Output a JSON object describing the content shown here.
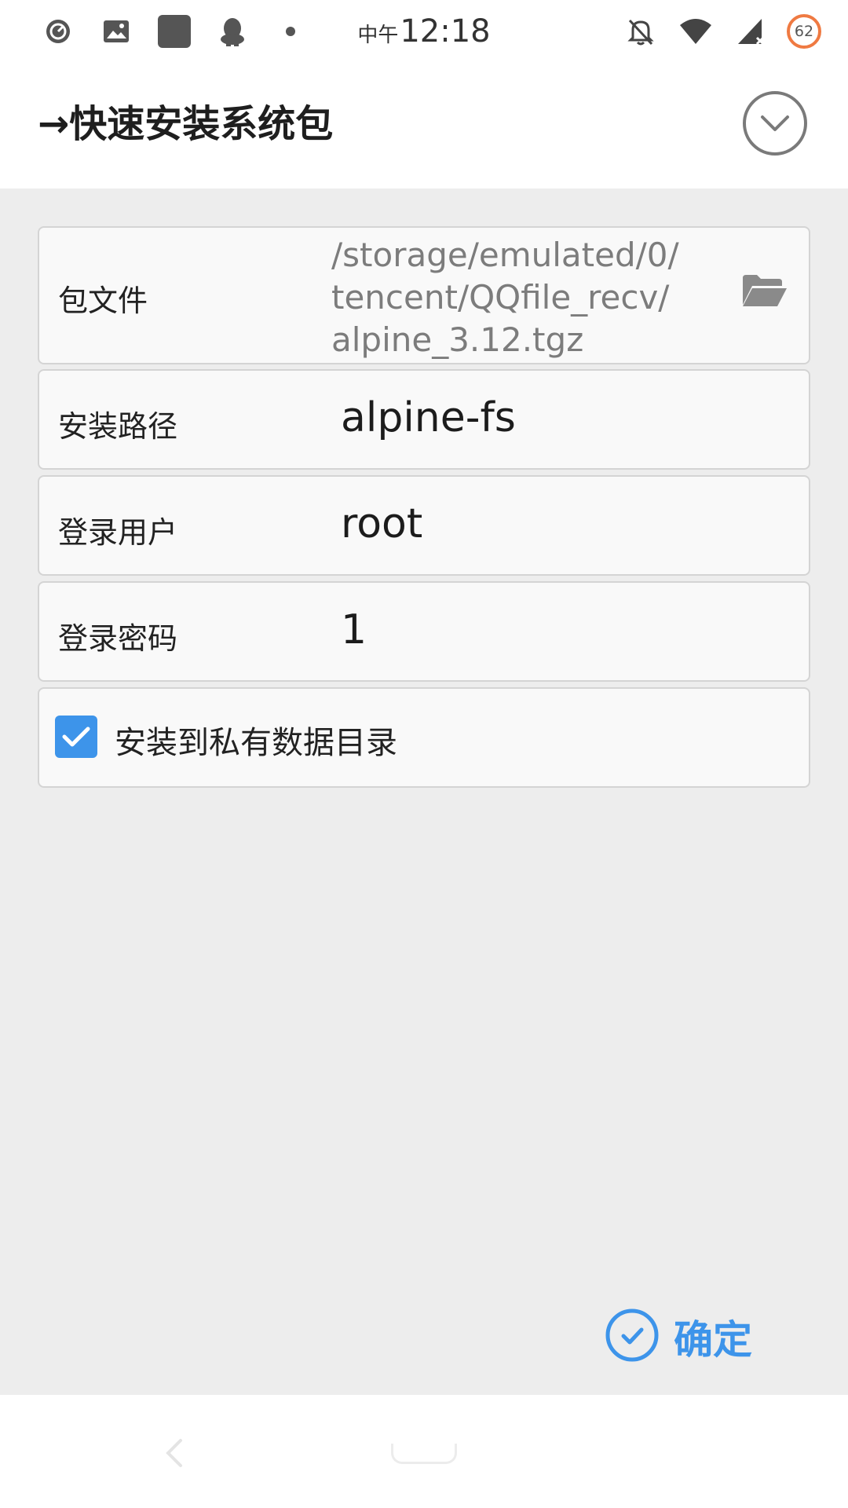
{
  "status_bar": {
    "ampm": "中午",
    "time": "12:18",
    "battery": "62",
    "left_icons": [
      "speed-icon",
      "gallery-icon",
      "app-icon",
      "qq-icon",
      "dot-icon"
    ],
    "right_icons": [
      "bell-off-icon",
      "wifi-icon",
      "signal-icon",
      "battery-icon"
    ]
  },
  "header": {
    "title": "→快速安装系统包",
    "collapse_icon": "chevron-down-circle-icon"
  },
  "form": {
    "package_file": {
      "label": "包文件",
      "value": "/storage/emulated/0/\ntencent/QQfile_recv/\nalpine_3.12.tgz",
      "icon": "folder-open-icon"
    },
    "install_path": {
      "label": "安装路径",
      "value": "alpine-fs"
    },
    "login_user": {
      "label": "登录用户",
      "value": "root"
    },
    "login_password": {
      "label": "登录密码",
      "value": "1"
    },
    "private_dir": {
      "label": "安装到私有数据目录",
      "checked": true
    }
  },
  "confirm": {
    "label": "确定",
    "icon": "check-circle-icon"
  },
  "colors": {
    "accent": "#3d94ea",
    "background": "#ededed",
    "battery": "#ef7a42"
  }
}
